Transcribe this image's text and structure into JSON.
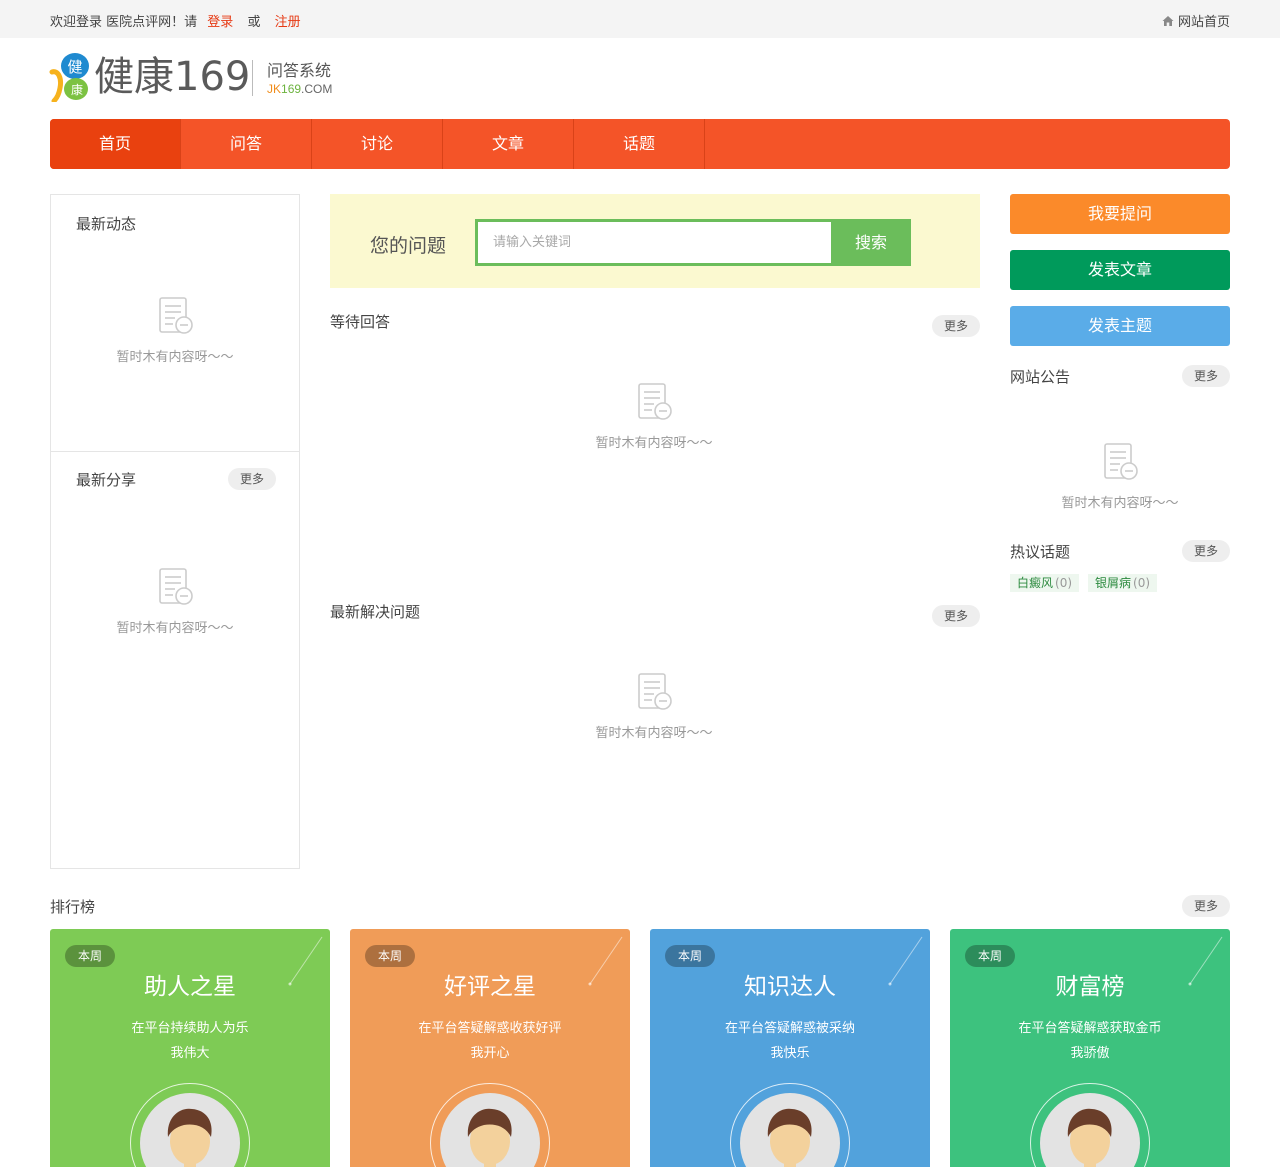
{
  "topbar": {
    "welcome": "欢迎登录 医院点评网！请",
    "login": "登录",
    "or": "或",
    "register": "注册",
    "home_link": "网站首页"
  },
  "logo": {
    "brand": "健康169",
    "mark_char_top": "健",
    "mark_char_bottom": "康",
    "subtitle": "问答系统",
    "url_a": "JK",
    "url_b": "169",
    "url_c": ".COM"
  },
  "nav": {
    "items": [
      {
        "label": "首页",
        "active": true
      },
      {
        "label": "问答",
        "active": false
      },
      {
        "label": "讨论",
        "active": false
      },
      {
        "label": "文章",
        "active": false
      },
      {
        "label": "话题",
        "active": false
      }
    ]
  },
  "left": {
    "latest_activity_title": "最新动态",
    "latest_share_title": "最新分享",
    "more": "更多"
  },
  "empty_text": "暂时木有内容呀～～",
  "search": {
    "label": "您的问题",
    "placeholder": "请输入关键词",
    "button": "搜索"
  },
  "center": {
    "waiting_title": "等待回答",
    "solved_title": "最新解决问题",
    "more": "更多"
  },
  "right": {
    "ask_button": "我要提问",
    "article_button": "发表文章",
    "topic_button": "发表主题",
    "notice_title": "网站公告",
    "hot_title": "热议话题",
    "more": "更多",
    "hot_tags": [
      {
        "name": "白癜风",
        "count": "(0)"
      },
      {
        "name": "银屑病",
        "count": "(0)"
      }
    ]
  },
  "colors": {
    "nav": "#f45428",
    "nav_active": "#e9410f",
    "ask": "#fb8a2a",
    "article": "#009a5b",
    "topic": "#5aace8",
    "search_green": "#6bbd5b"
  },
  "ranking": {
    "title": "排行榜",
    "more": "更多",
    "cards": [
      {
        "badge": "本周",
        "title": "助人之星",
        "line1": "在平台持续助人为乐",
        "line2": "我伟大",
        "color": "#7ecb55"
      },
      {
        "badge": "本周",
        "title": "好评之星",
        "line1": "在平台答疑解惑收获好评",
        "line2": "我开心",
        "color": "#f09c58"
      },
      {
        "badge": "本周",
        "title": "知识达人",
        "line1": "在平台答疑解惑被采纳",
        "line2": "我快乐",
        "color": "#52a2dc"
      },
      {
        "badge": "本周",
        "title": "财富榜",
        "line1": "在平台答疑解惑获取金币",
        "line2": "我骄傲",
        "color": "#3dc27e"
      }
    ]
  }
}
